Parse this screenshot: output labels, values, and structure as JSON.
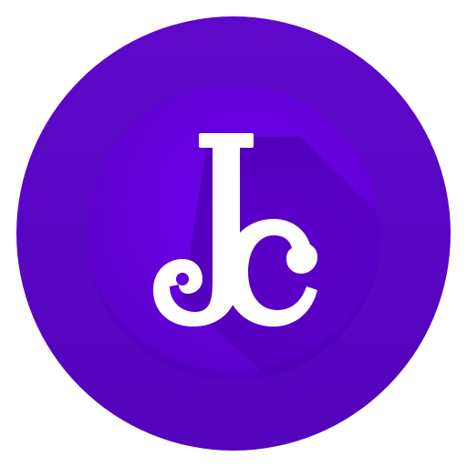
{
  "logo": {
    "name": "jc-monogram-logo",
    "letters": "Jc",
    "colors": {
      "outer_ring": "#5b06c6",
      "inner_disc": "#6a00e8",
      "inner_disc_shade": "#4d00ad",
      "long_shadow": "#4a02a6",
      "glyph": "#ffffff",
      "background": "#ffffff"
    }
  }
}
